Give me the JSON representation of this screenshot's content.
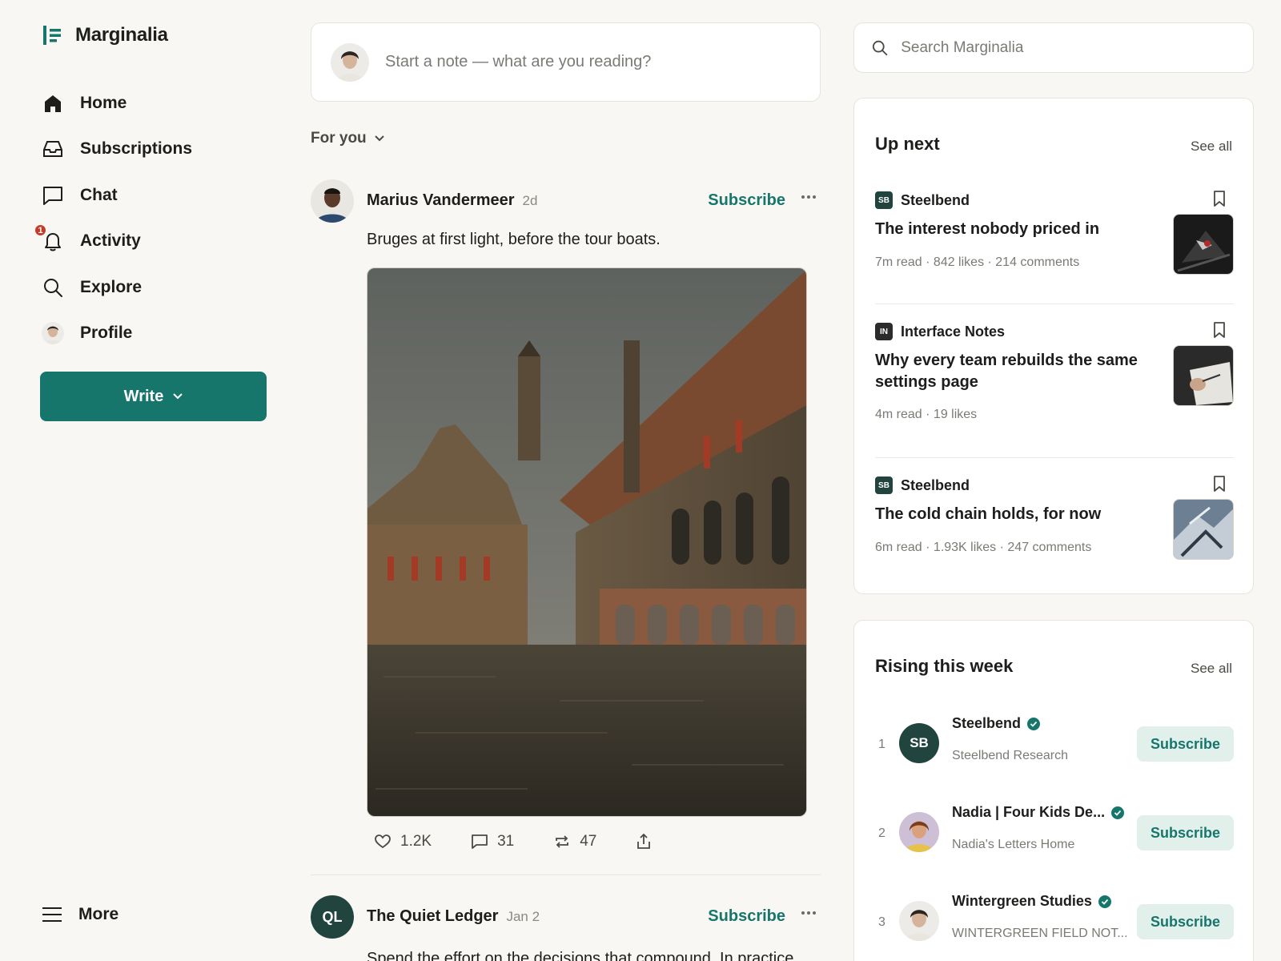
{
  "app": {
    "name": "Marginalia"
  },
  "sidebar": {
    "items": [
      {
        "label": "Home",
        "icon": "home-icon"
      },
      {
        "label": "Subscriptions",
        "icon": "inbox-icon"
      },
      {
        "label": "Chat",
        "icon": "chat-icon"
      },
      {
        "label": "Activity",
        "icon": "bell-icon",
        "badge": "1"
      },
      {
        "label": "Explore",
        "icon": "search-icon"
      },
      {
        "label": "Profile",
        "icon": "avatar"
      }
    ],
    "write_label": "Write",
    "more_label": "More"
  },
  "composer": {
    "placeholder": "Start a note — what are you reading?"
  },
  "feed": {
    "filter_label": "For you",
    "posts": [
      {
        "author": "Marius Vandermeer",
        "time": "2d",
        "subscribe_label": "Subscribe",
        "text": "Bruges at first light, before the tour boats.",
        "likes": "1.2K",
        "comments": "31",
        "restacks": "47"
      },
      {
        "author": "The Quiet Ledger",
        "initials": "QL",
        "time": "Jan 2",
        "subscribe_label": "Subscribe",
        "text": "Spend the effort on the decisions that compound. In practice"
      }
    ]
  },
  "search": {
    "placeholder": "Search Marginalia"
  },
  "up_next": {
    "title": "Up next",
    "see_all": "See all",
    "stories": [
      {
        "pub": "Steelbend",
        "pub_initials": "SB",
        "title": "The interest nobody priced in",
        "meta": "7m read · 842 likes · 214 comments"
      },
      {
        "pub": "Interface Notes",
        "pub_initials": "IN",
        "title": "Why every team rebuilds the same settings page",
        "meta": "4m read · 19 likes"
      },
      {
        "pub": "Steelbend",
        "pub_initials": "SB",
        "title": "The cold chain holds, for now",
        "meta": "6m read · 1.93K likes · 247 comments"
      }
    ]
  },
  "rising": {
    "title": "Rising this week",
    "see_all": "See all",
    "items": [
      {
        "rank": "1",
        "name": "Steelbend",
        "initials": "SB",
        "sub": "Steelbend Research",
        "button": "Subscribe"
      },
      {
        "rank": "2",
        "name": "Nadia | Four Kids De...",
        "sub": "Nadia's Letters Home",
        "button": "Subscribe"
      },
      {
        "rank": "3",
        "name": "Wintergreen Studies",
        "sub": "WINTERGREEN FIELD NOT...",
        "button": "Subscribe"
      }
    ]
  },
  "colors": {
    "accent": "#17766c",
    "accent_light": "#e2f0ec",
    "badge": "#c43b2b",
    "background": "#f8f7f3"
  }
}
